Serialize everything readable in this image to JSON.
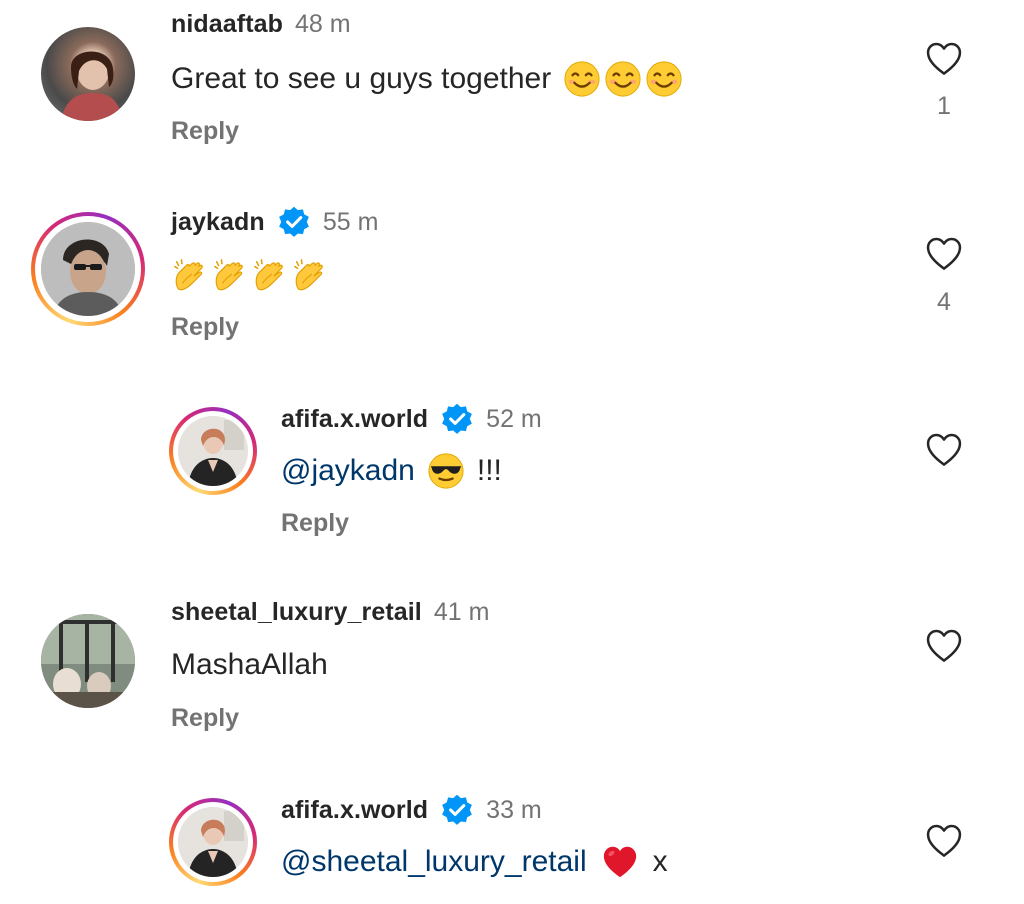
{
  "comments": [
    {
      "username": "nidaaftab",
      "time": "48 m",
      "text": "Great to see u guys together",
      "emojis": [
        "smiling-face",
        "smiling-face",
        "smiling-face"
      ],
      "reply_label": "Reply",
      "likes": "1",
      "verified": false
    },
    {
      "username": "jaykadn",
      "time": "55 m",
      "text": "",
      "emojis": [
        "clapping-hands",
        "clapping-hands",
        "clapping-hands",
        "clapping-hands"
      ],
      "reply_label": "Reply",
      "likes": "4",
      "verified": true
    },
    {
      "username": "afifa.x.world",
      "time": "52 m",
      "mention": "@jaykadn",
      "suffix": "!!!",
      "emojis": [
        "sunglasses-face"
      ],
      "reply_label": "Reply",
      "verified": true
    },
    {
      "username": "sheetal_luxury_retail",
      "time": "41 m",
      "text": "MashaAllah",
      "reply_label": "Reply",
      "verified": false
    },
    {
      "username": "afifa.x.world",
      "time": "33 m",
      "mention": "@sheetal_luxury_retail",
      "suffix": "x",
      "emojis": [
        "red-heart"
      ],
      "verified": true
    }
  ],
  "colors": {
    "text": "#262626",
    "secondary": "#737373",
    "mention": "#00376b",
    "verified": "#0095f6"
  }
}
